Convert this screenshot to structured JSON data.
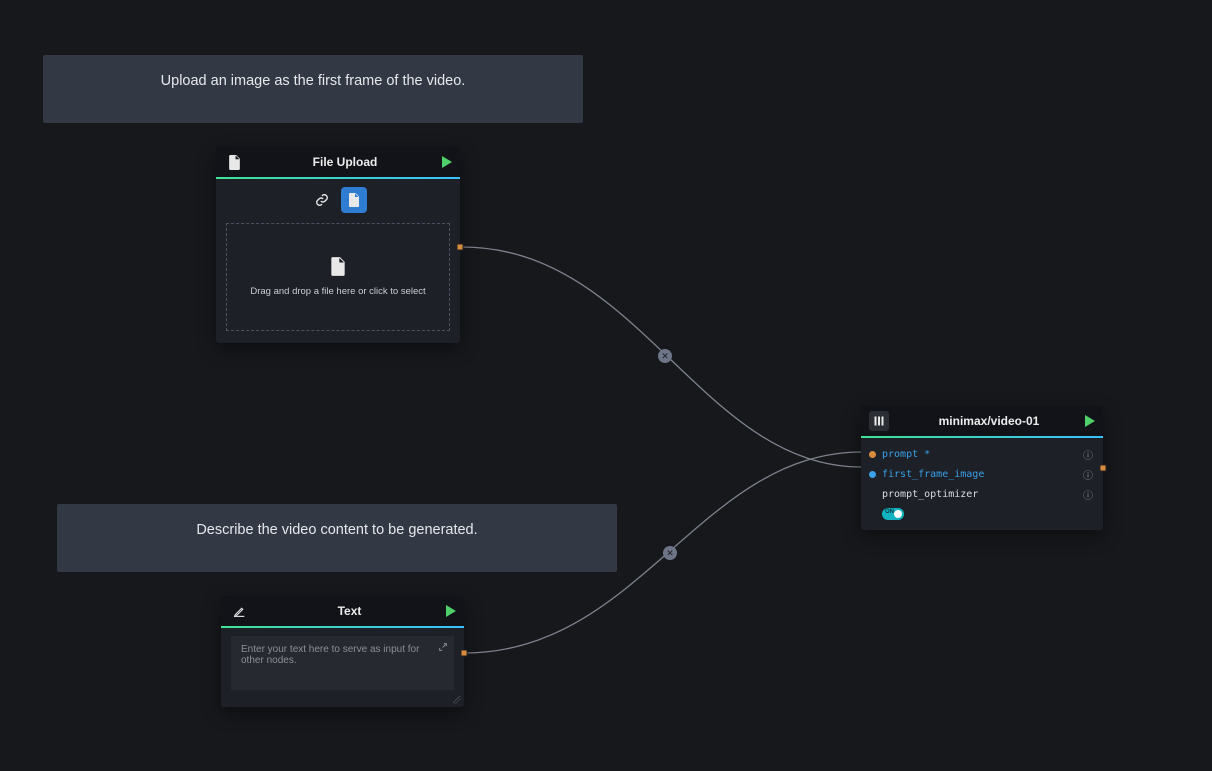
{
  "comment1": {
    "text": "Upload an image as the first frame of the video."
  },
  "comment2": {
    "text": "Describe the video content to be generated."
  },
  "file_node": {
    "title": "File Upload",
    "dropzone_text": "Drag and drop a file here or click to select"
  },
  "text_node": {
    "title": "Text",
    "placeholder": "Enter your text here to serve as input for other nodes."
  },
  "model_node": {
    "title": "minimax/video-01",
    "params": {
      "prompt": "prompt",
      "first_frame_image": "first_frame_image",
      "prompt_optimizer": "prompt_optimizer"
    },
    "toggle_on_label": "ON"
  }
}
